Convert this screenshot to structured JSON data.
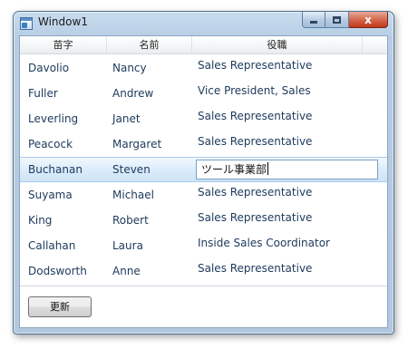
{
  "window": {
    "title": "Window1",
    "buttons": {
      "minimize": "minimize",
      "maximize": "maximize",
      "close": "x"
    }
  },
  "grid": {
    "columns": [
      "苗字",
      "名前",
      "役職"
    ],
    "rows": [
      {
        "last": "Davolio",
        "first": "Nancy",
        "title": "Sales Representative"
      },
      {
        "last": "Fuller",
        "first": "Andrew",
        "title": "Vice President, Sales"
      },
      {
        "last": "Leverling",
        "first": "Janet",
        "title": "Sales Representative"
      },
      {
        "last": "Peacock",
        "first": "Margaret",
        "title": "Sales Representative"
      },
      {
        "last": "Buchanan",
        "first": "Steven",
        "title": "ツール事業部"
      },
      {
        "last": "Suyama",
        "first": "Michael",
        "title": "Sales Representative"
      },
      {
        "last": "King",
        "first": "Robert",
        "title": "Sales Representative"
      },
      {
        "last": "Callahan",
        "first": "Laura",
        "title": "Inside Sales Coordinator"
      },
      {
        "last": "Dodsworth",
        "first": "Anne",
        "title": "Sales Representative"
      }
    ],
    "selected_row_index": 4
  },
  "footer": {
    "update_label": "更新"
  }
}
